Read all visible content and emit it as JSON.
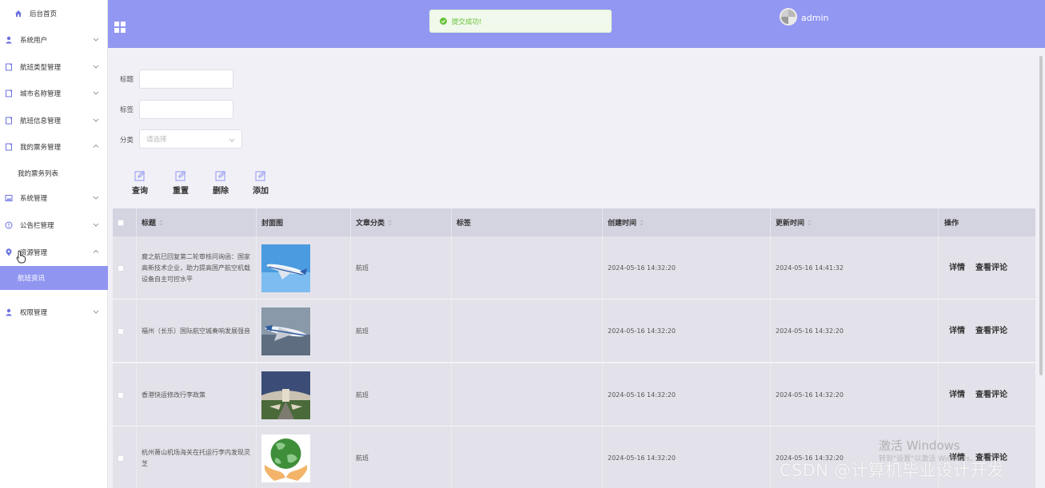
{
  "sidebar": {
    "items": [
      {
        "label": "后台首页",
        "icon": "home-icon"
      },
      {
        "label": "系统用户",
        "icon": "user-icon"
      },
      {
        "label": "航班类型管理",
        "icon": "doc-icon"
      },
      {
        "label": "城市名称管理",
        "icon": "doc-icon"
      },
      {
        "label": "航班信息管理",
        "icon": "doc-icon"
      },
      {
        "label": "我的票务管理",
        "icon": "doc-icon"
      },
      {
        "label": "我的票务列表",
        "icon": ""
      },
      {
        "label": "系统管理",
        "icon": "image-icon"
      },
      {
        "label": "公告栏管理",
        "icon": "info-icon"
      },
      {
        "label": "资源管理",
        "icon": "location-icon"
      },
      {
        "label": "航班资讯",
        "icon": ""
      },
      {
        "label": "权限管理",
        "icon": "user-icon"
      }
    ]
  },
  "header": {
    "toast": "提交成功!",
    "username": "admin"
  },
  "search": {
    "title_label": "标题",
    "tag_label": "标签",
    "category_label": "分类",
    "category_placeholder": "请选择"
  },
  "toolbar": {
    "query": "查询",
    "reset": "重置",
    "delete": "删除",
    "add": "添加"
  },
  "table": {
    "columns": [
      "标题",
      "封面图",
      "文章分类",
      "标签",
      "创建时间",
      "更新时间",
      "操作"
    ],
    "detail_label": "详情",
    "comment_label": "查看评论",
    "rows": [
      {
        "title": "腐之航已回复第二轮审核问询函：国家高新技术企业，助力提高国产航空机载设备自主可控水平",
        "category": "航班",
        "tag": "",
        "created": "2024-05-16 14:32:20",
        "updated": "2024-05-16 14:41:32"
      },
      {
        "title": "福州（长乐）国际航空城奏响发展强音",
        "category": "航班",
        "tag": "",
        "created": "2024-05-16 14:32:20",
        "updated": "2024-05-16 14:32:20"
      },
      {
        "title": "香港快运修改行李政策",
        "category": "航班",
        "tag": "",
        "created": "2024-05-16 14:32:20",
        "updated": "2024-05-16 14:32:20"
      },
      {
        "title": "杭州萧山机场海关在托运行李内发现灵芝",
        "category": "航班",
        "tag": "",
        "created": "2024-05-16 14:32:20",
        "updated": "2024-05-16 14:32:20"
      }
    ]
  },
  "watermark": {
    "windows_line1": "激活 Windows",
    "windows_line2": "转到\"设置\"以激活 Windows。",
    "csdn": "CSDN @计算机毕业设计开发"
  },
  "colors": {
    "accent": "#9297f1",
    "active_item": "#9095f0",
    "success": "#67c23a"
  }
}
